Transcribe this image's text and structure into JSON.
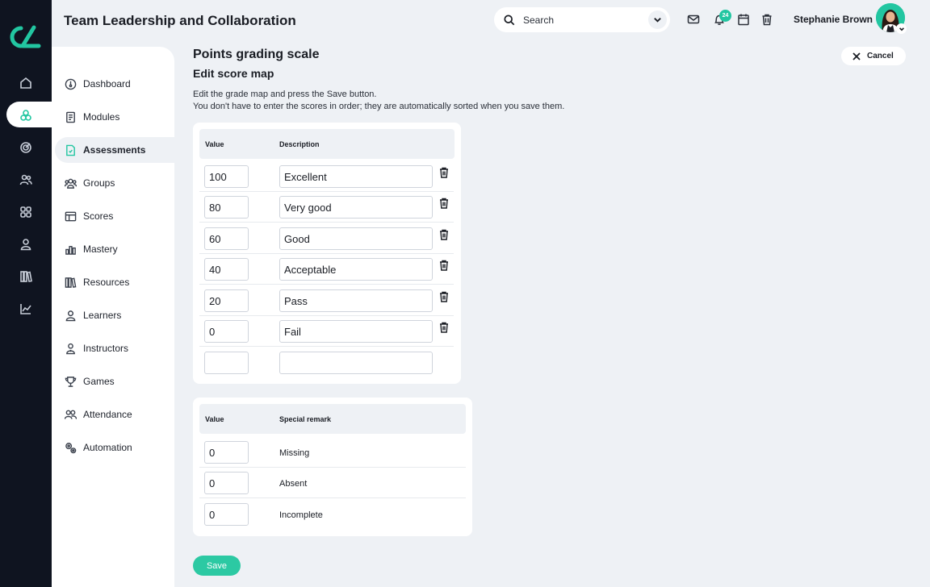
{
  "app": {
    "title": "Team Leadership and Collaboration"
  },
  "header": {
    "search_placeholder": "Search",
    "notification_count": "24",
    "user_name": "Stephanie Brown"
  },
  "rail": {
    "icons": [
      "home-icon",
      "modules-icon",
      "target-icon",
      "users-icon",
      "grid-icon",
      "user-icon",
      "library-icon",
      "chart-icon"
    ],
    "active_index": 1
  },
  "sidebar": {
    "items": [
      {
        "label": "Dashboard",
        "icon": "dashboard-icon"
      },
      {
        "label": "Modules",
        "icon": "modules-icon"
      },
      {
        "label": "Assessments",
        "icon": "assessments-icon",
        "active": true
      },
      {
        "label": "Groups",
        "icon": "groups-icon"
      },
      {
        "label": "Scores",
        "icon": "scores-icon"
      },
      {
        "label": "Mastery",
        "icon": "mastery-icon"
      },
      {
        "label": "Resources",
        "icon": "resources-icon"
      },
      {
        "label": "Learners",
        "icon": "learners-icon"
      },
      {
        "label": "Instructors",
        "icon": "instructors-icon"
      },
      {
        "label": "Games",
        "icon": "games-icon"
      },
      {
        "label": "Attendance",
        "icon": "attendance-icon"
      },
      {
        "label": "Automation",
        "icon": "automation-icon"
      }
    ]
  },
  "page": {
    "title": "Points grading scale",
    "subtitle": "Edit score map",
    "intro_line1": "Edit the grade map and press the Save button.",
    "intro_line2": "You don't have to enter the scores in order; they are automatically sorted when you save them.",
    "cancel_label": "Cancel",
    "save_label": "Save"
  },
  "score_table": {
    "col_value": "Value",
    "col_description": "Description",
    "rows": [
      {
        "value": "100",
        "description": "Excellent"
      },
      {
        "value": "80",
        "description": "Very good"
      },
      {
        "value": "60",
        "description": "Good"
      },
      {
        "value": "40",
        "description": "Acceptable"
      },
      {
        "value": "20",
        "description": "Pass"
      },
      {
        "value": "0",
        "description": "Fail"
      },
      {
        "value": "",
        "description": ""
      }
    ]
  },
  "special_table": {
    "col_value": "Value",
    "col_remark": "Special remark",
    "rows": [
      {
        "value": "0",
        "remark": "Missing"
      },
      {
        "value": "0",
        "remark": "Absent"
      },
      {
        "value": "0",
        "remark": "Incomplete"
      }
    ]
  },
  "colors": {
    "accent": "#22c6a1",
    "rail": "#0f1420",
    "background": "#eef1f5"
  }
}
